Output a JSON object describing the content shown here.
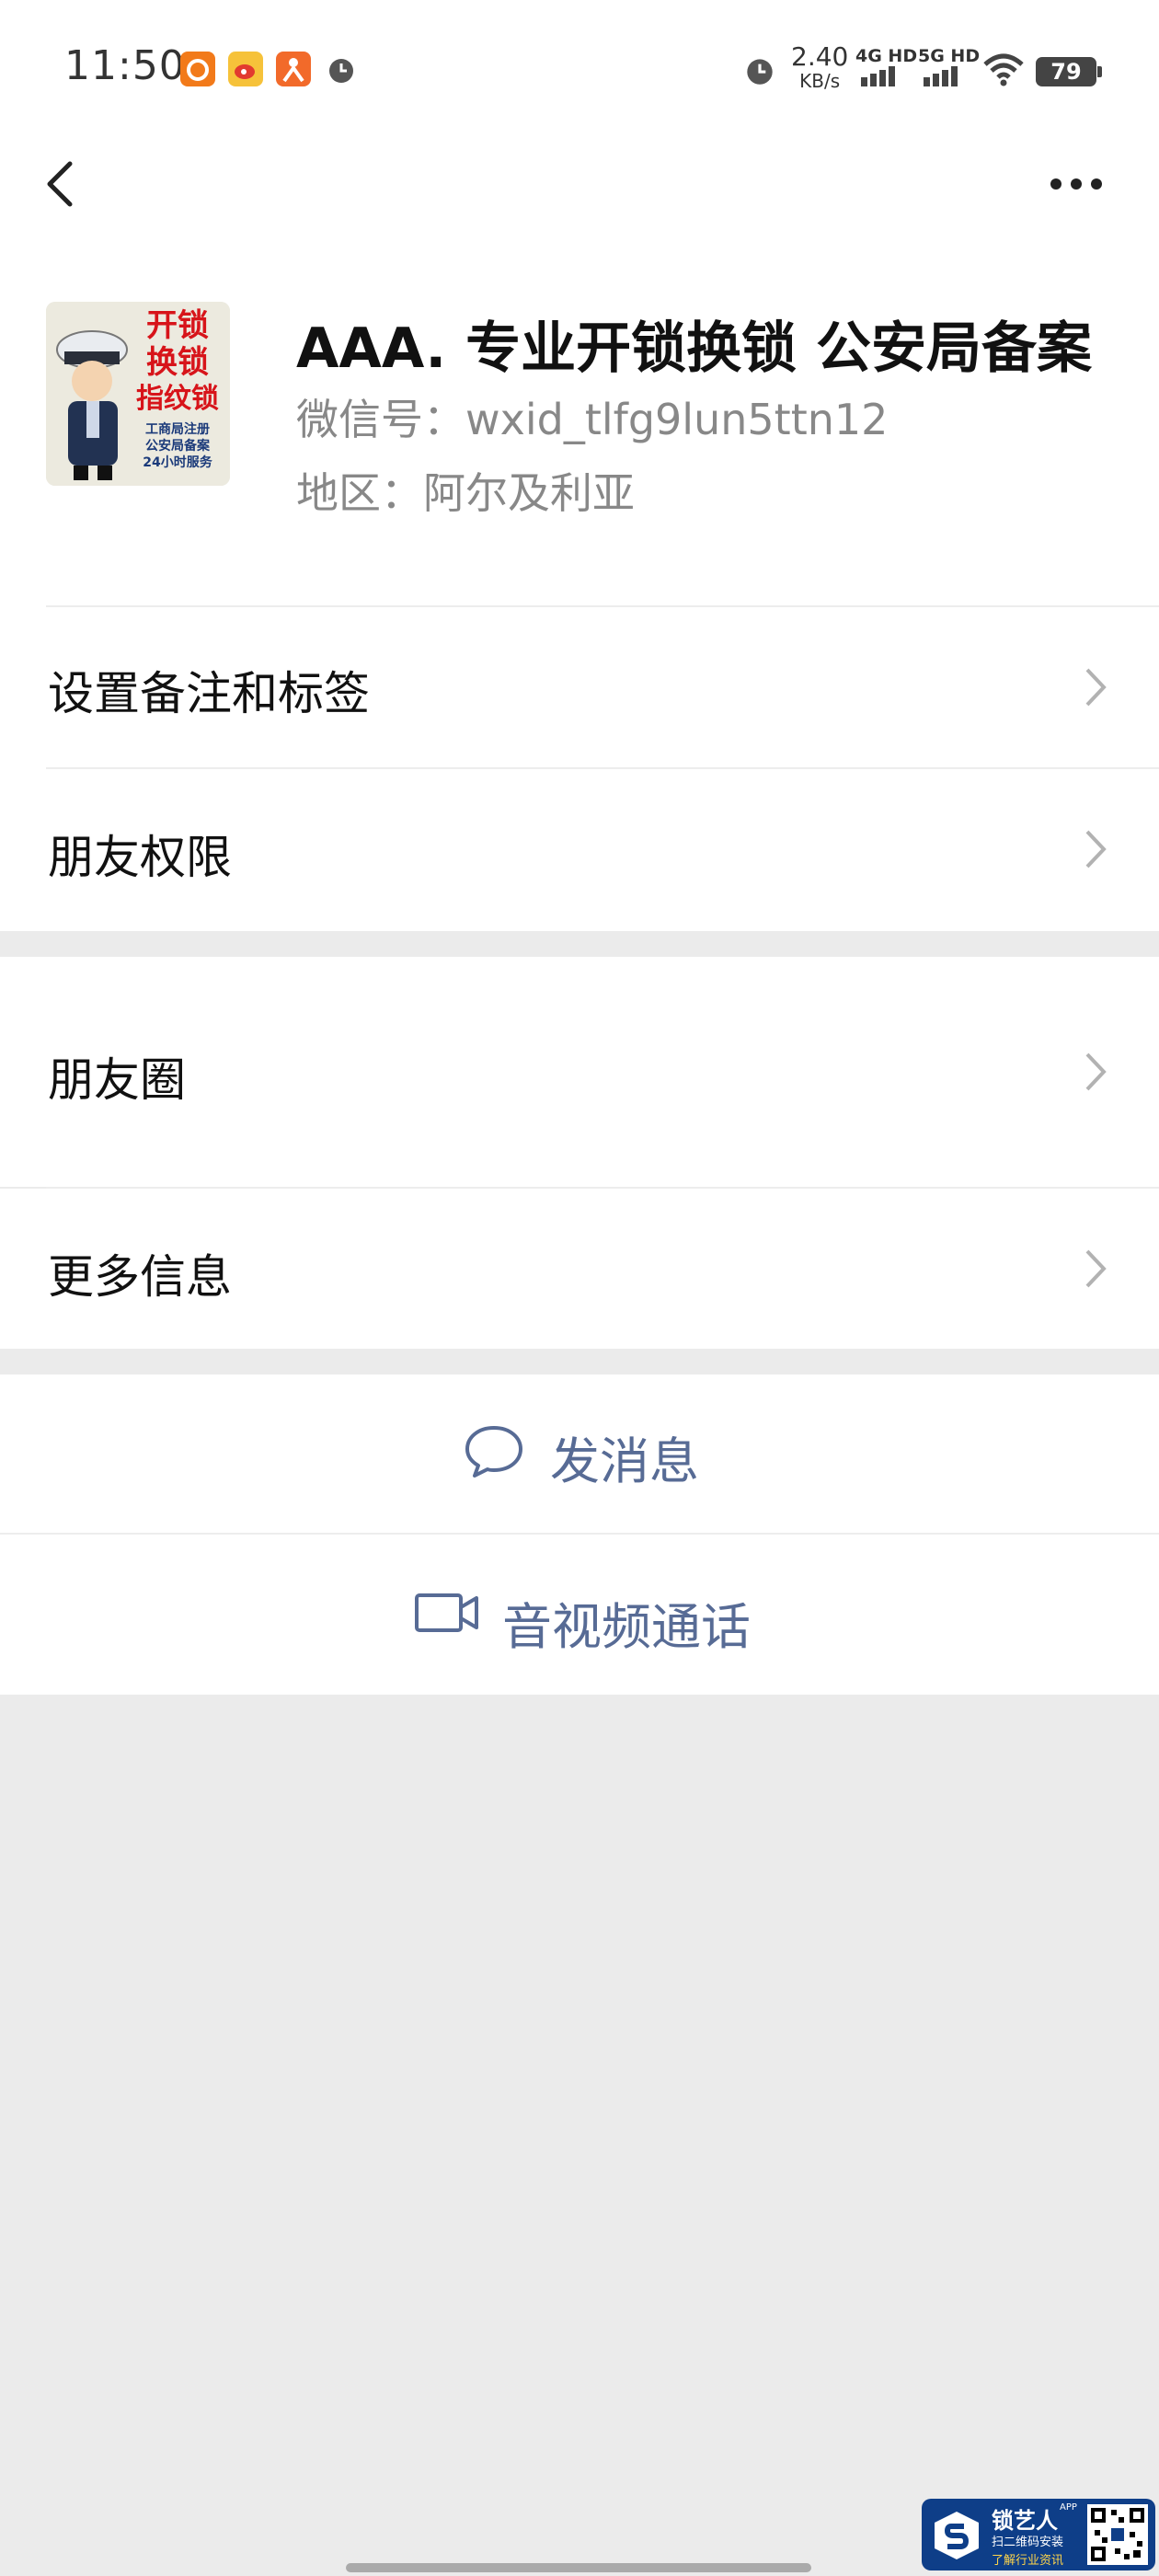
{
  "status_bar": {
    "time": "11:50",
    "net_speed": "2.40",
    "net_unit": "KB/s",
    "sim1": "4G HD",
    "sim2": "5G HD",
    "battery": "79",
    "icons": [
      "taobao-icon",
      "weibo-icon",
      "app-icon",
      "alarm-icon",
      "alarm-icon",
      "wifi-icon",
      "battery-icon"
    ]
  },
  "nav": {
    "back_icon": "chevron-left-icon",
    "more_icon": "more-icon"
  },
  "profile": {
    "name": "AAA. 专业开锁换锁 公安局备案",
    "wechat_id": "微信号：wxid_tlfg9lun5ttn12",
    "region": "地区：阿尔及利亚",
    "avatar_text": [
      "开锁",
      "换锁",
      "指纹锁",
      "工商局注册",
      "公安局备案",
      "24小时服务"
    ]
  },
  "menu": {
    "remark_tags": "设置备注和标签",
    "friend_permissions": "朋友权限",
    "moments": "朋友圈",
    "more_info": "更多信息"
  },
  "actions": {
    "send_message": "发消息",
    "video_call": "音视频通话"
  },
  "watermark": {
    "title": "锁艺人",
    "app": "APP",
    "line1": "扫二维码安装",
    "line2": "了解行业资讯"
  },
  "colors": {
    "link_blue": "#576b95",
    "background": "#ebebeb"
  }
}
